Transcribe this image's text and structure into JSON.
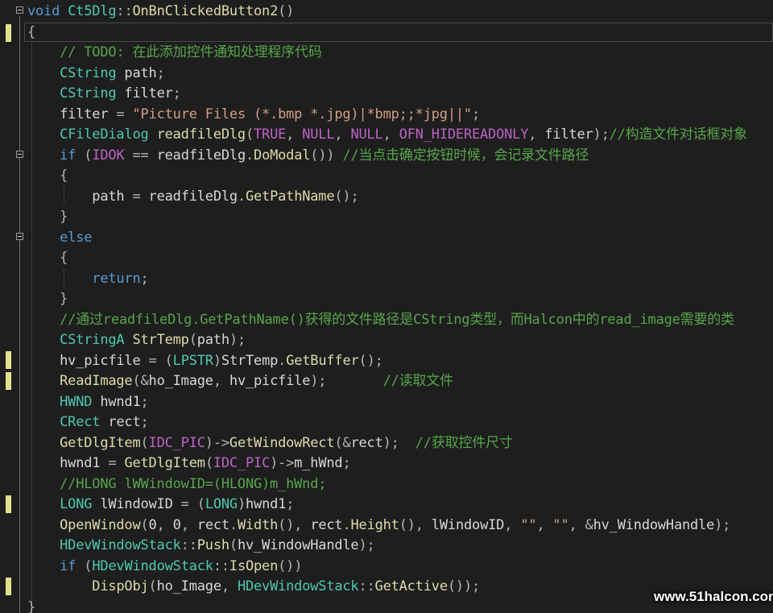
{
  "window": {
    "title": "Visual Studio code editor - Ct5Dlg::OnBnClickedButton2"
  },
  "colors": {
    "background": "#1e1e1e",
    "keyword": "#569cd6",
    "type": "#4ec9b0",
    "function": "#dcdcaa",
    "comment": "#57a64a",
    "string": "#d69d85",
    "macro": "#bd63c5",
    "change_marker": "#e2e28a"
  },
  "code_lines": [
    [
      [
        "kw",
        "void"
      ],
      [
        "id",
        " "
      ],
      [
        "ty",
        "Ct5Dlg"
      ],
      [
        "pn",
        "::"
      ],
      [
        "fn",
        "OnBnClickedButton2"
      ],
      [
        "pn",
        "()"
      ]
    ],
    [
      [
        "pn",
        "{"
      ]
    ],
    [
      [
        "id",
        "    "
      ],
      [
        "cm",
        "// TODO: 在此添加控件通知处理程序代码"
      ]
    ],
    [
      [
        "id",
        "    "
      ],
      [
        "ty",
        "CString"
      ],
      [
        "id",
        " path"
      ],
      [
        "pn",
        ";"
      ]
    ],
    [
      [
        "id",
        "    "
      ],
      [
        "ty",
        "CString"
      ],
      [
        "id",
        " filter"
      ],
      [
        "pn",
        ";"
      ]
    ],
    [
      [
        "id",
        "    filter "
      ],
      [
        "pn",
        "="
      ],
      [
        "id",
        " "
      ],
      [
        "st",
        "\"Picture Files (*.bmp *.jpg)|*bmp;;*jpg||\""
      ],
      [
        "pn",
        ";"
      ]
    ],
    [
      [
        "id",
        "    "
      ],
      [
        "ty",
        "CFileDialog"
      ],
      [
        "id",
        " "
      ],
      [
        "fn",
        "readfileDlg"
      ],
      [
        "pn",
        "("
      ],
      [
        "mc",
        "TRUE"
      ],
      [
        "pn",
        ", "
      ],
      [
        "mc",
        "NULL"
      ],
      [
        "pn",
        ", "
      ],
      [
        "mc",
        "NULL"
      ],
      [
        "pn",
        ", "
      ],
      [
        "mc",
        "OFN_HIDEREADONLY"
      ],
      [
        "pn",
        ", "
      ],
      [
        "id",
        "filter"
      ],
      [
        "pn",
        ");"
      ],
      [
        "cm",
        "//构造文件对话框对象"
      ]
    ],
    [
      [
        "id",
        "    "
      ],
      [
        "kw",
        "if"
      ],
      [
        "id",
        " "
      ],
      [
        "pn",
        "("
      ],
      [
        "mc",
        "IDOK"
      ],
      [
        "id",
        " "
      ],
      [
        "pn",
        "=="
      ],
      [
        "id",
        " readfileDlg"
      ],
      [
        "pn",
        "."
      ],
      [
        "fn",
        "DoModal"
      ],
      [
        "pn",
        "())"
      ],
      [
        "id",
        " "
      ],
      [
        "cm",
        "//当点击确定按钮时候，会记录文件路径"
      ]
    ],
    [
      [
        "id",
        "    "
      ],
      [
        "pn",
        "{"
      ]
    ],
    [
      [
        "id",
        "        path "
      ],
      [
        "pn",
        "="
      ],
      [
        "id",
        " readfileDlg"
      ],
      [
        "pn",
        "."
      ],
      [
        "fn",
        "GetPathName"
      ],
      [
        "pn",
        "();"
      ]
    ],
    [
      [
        "id",
        "    "
      ],
      [
        "pn",
        "}"
      ]
    ],
    [
      [
        "id",
        "    "
      ],
      [
        "kw",
        "else"
      ]
    ],
    [
      [
        "id",
        "    "
      ],
      [
        "pn",
        "{"
      ]
    ],
    [
      [
        "id",
        "        "
      ],
      [
        "kw",
        "return"
      ],
      [
        "pn",
        ";"
      ]
    ],
    [
      [
        "id",
        "    "
      ],
      [
        "pn",
        "}"
      ]
    ],
    [
      [
        "id",
        "    "
      ],
      [
        "cm",
        "//通过readfileDlg.GetPathName()获得的文件路径是CString类型，而Halcon中的read_image需要的类"
      ]
    ],
    [
      [
        "id",
        "    "
      ],
      [
        "ty",
        "CStringA"
      ],
      [
        "id",
        " "
      ],
      [
        "fn",
        "StrTemp"
      ],
      [
        "pn",
        "("
      ],
      [
        "id",
        "path"
      ],
      [
        "pn",
        ");"
      ]
    ],
    [
      [
        "id",
        "    hv_picfile "
      ],
      [
        "pn",
        "="
      ],
      [
        "id",
        " "
      ],
      [
        "pn",
        "("
      ],
      [
        "ty",
        "LPSTR"
      ],
      [
        "pn",
        ")"
      ],
      [
        "id",
        "StrTemp"
      ],
      [
        "pn",
        "."
      ],
      [
        "fn",
        "GetBuffer"
      ],
      [
        "pn",
        "();"
      ]
    ],
    [
      [
        "id",
        "    "
      ],
      [
        "fn",
        "ReadImage"
      ],
      [
        "pn",
        "(&"
      ],
      [
        "id",
        "ho_Image"
      ],
      [
        "pn",
        ", "
      ],
      [
        "id",
        "hv_picfile"
      ],
      [
        "pn",
        ");"
      ],
      [
        "id",
        "       "
      ],
      [
        "cm",
        "//读取文件"
      ]
    ],
    [
      [
        "id",
        "    "
      ],
      [
        "ty",
        "HWND"
      ],
      [
        "id",
        " hwnd1"
      ],
      [
        "pn",
        ";"
      ]
    ],
    [
      [
        "id",
        "    "
      ],
      [
        "ty",
        "CRect"
      ],
      [
        "id",
        " rect"
      ],
      [
        "pn",
        ";"
      ]
    ],
    [
      [
        "id",
        "    "
      ],
      [
        "fn",
        "GetDlgItem"
      ],
      [
        "pn",
        "("
      ],
      [
        "mc",
        "IDC_PIC"
      ],
      [
        "pn",
        ")->"
      ],
      [
        "fn",
        "GetWindowRect"
      ],
      [
        "pn",
        "(&"
      ],
      [
        "id",
        "rect"
      ],
      [
        "pn",
        ");"
      ],
      [
        "id",
        "  "
      ],
      [
        "cm",
        "//获取控件尺寸"
      ]
    ],
    [
      [
        "id",
        "    hwnd1 "
      ],
      [
        "pn",
        "="
      ],
      [
        "id",
        " "
      ],
      [
        "fn",
        "GetDlgItem"
      ],
      [
        "pn",
        "("
      ],
      [
        "mc",
        "IDC_PIC"
      ],
      [
        "pn",
        ")->"
      ],
      [
        "id",
        "m_hWnd"
      ],
      [
        "pn",
        ";"
      ]
    ],
    [
      [
        "id",
        "    "
      ],
      [
        "cm",
        "//HLONG lWWindowID=(HLONG)m_hWnd;"
      ]
    ],
    [
      [
        "id",
        "    "
      ],
      [
        "ty",
        "LONG"
      ],
      [
        "id",
        " lWindowID "
      ],
      [
        "pn",
        "="
      ],
      [
        "id",
        " "
      ],
      [
        "pn",
        "("
      ],
      [
        "ty",
        "LONG"
      ],
      [
        "pn",
        ")"
      ],
      [
        "id",
        "hwnd1"
      ],
      [
        "pn",
        ";"
      ]
    ],
    [
      [
        "id",
        "    "
      ],
      [
        "fn",
        "OpenWindow"
      ],
      [
        "pn",
        "("
      ],
      [
        "id",
        "0"
      ],
      [
        "pn",
        ", "
      ],
      [
        "id",
        "0"
      ],
      [
        "pn",
        ", "
      ],
      [
        "id",
        "rect"
      ],
      [
        "pn",
        "."
      ],
      [
        "fn",
        "Width"
      ],
      [
        "pn",
        "(), "
      ],
      [
        "id",
        "rect"
      ],
      [
        "pn",
        "."
      ],
      [
        "fn",
        "Height"
      ],
      [
        "pn",
        "(), "
      ],
      [
        "id",
        "lWindowID"
      ],
      [
        "pn",
        ", "
      ],
      [
        "st",
        "\"\""
      ],
      [
        "pn",
        ", "
      ],
      [
        "st",
        "\"\""
      ],
      [
        "pn",
        ", &"
      ],
      [
        "id",
        "hv_WindowHandle"
      ],
      [
        "pn",
        ");"
      ]
    ],
    [
      [
        "id",
        "    "
      ],
      [
        "ty",
        "HDevWindowStack"
      ],
      [
        "pn",
        "::"
      ],
      [
        "fn",
        "Push"
      ],
      [
        "pn",
        "("
      ],
      [
        "id",
        "hv_WindowHandle"
      ],
      [
        "pn",
        ");"
      ]
    ],
    [
      [
        "id",
        "    "
      ],
      [
        "kw",
        "if"
      ],
      [
        "id",
        " "
      ],
      [
        "pn",
        "("
      ],
      [
        "ty",
        "HDevWindowStack"
      ],
      [
        "pn",
        "::"
      ],
      [
        "fn",
        "IsOpen"
      ],
      [
        "pn",
        "())"
      ]
    ],
    [
      [
        "id",
        "        "
      ],
      [
        "fn",
        "DispObj"
      ],
      [
        "pn",
        "("
      ],
      [
        "id",
        "ho_Image"
      ],
      [
        "pn",
        ", "
      ],
      [
        "ty",
        "HDevWindowStack"
      ],
      [
        "pn",
        "::"
      ],
      [
        "fn",
        "GetActive"
      ],
      [
        "pn",
        "());"
      ]
    ],
    [
      [
        "pn",
        "}"
      ]
    ]
  ],
  "watermark": "www.51halcon.com"
}
